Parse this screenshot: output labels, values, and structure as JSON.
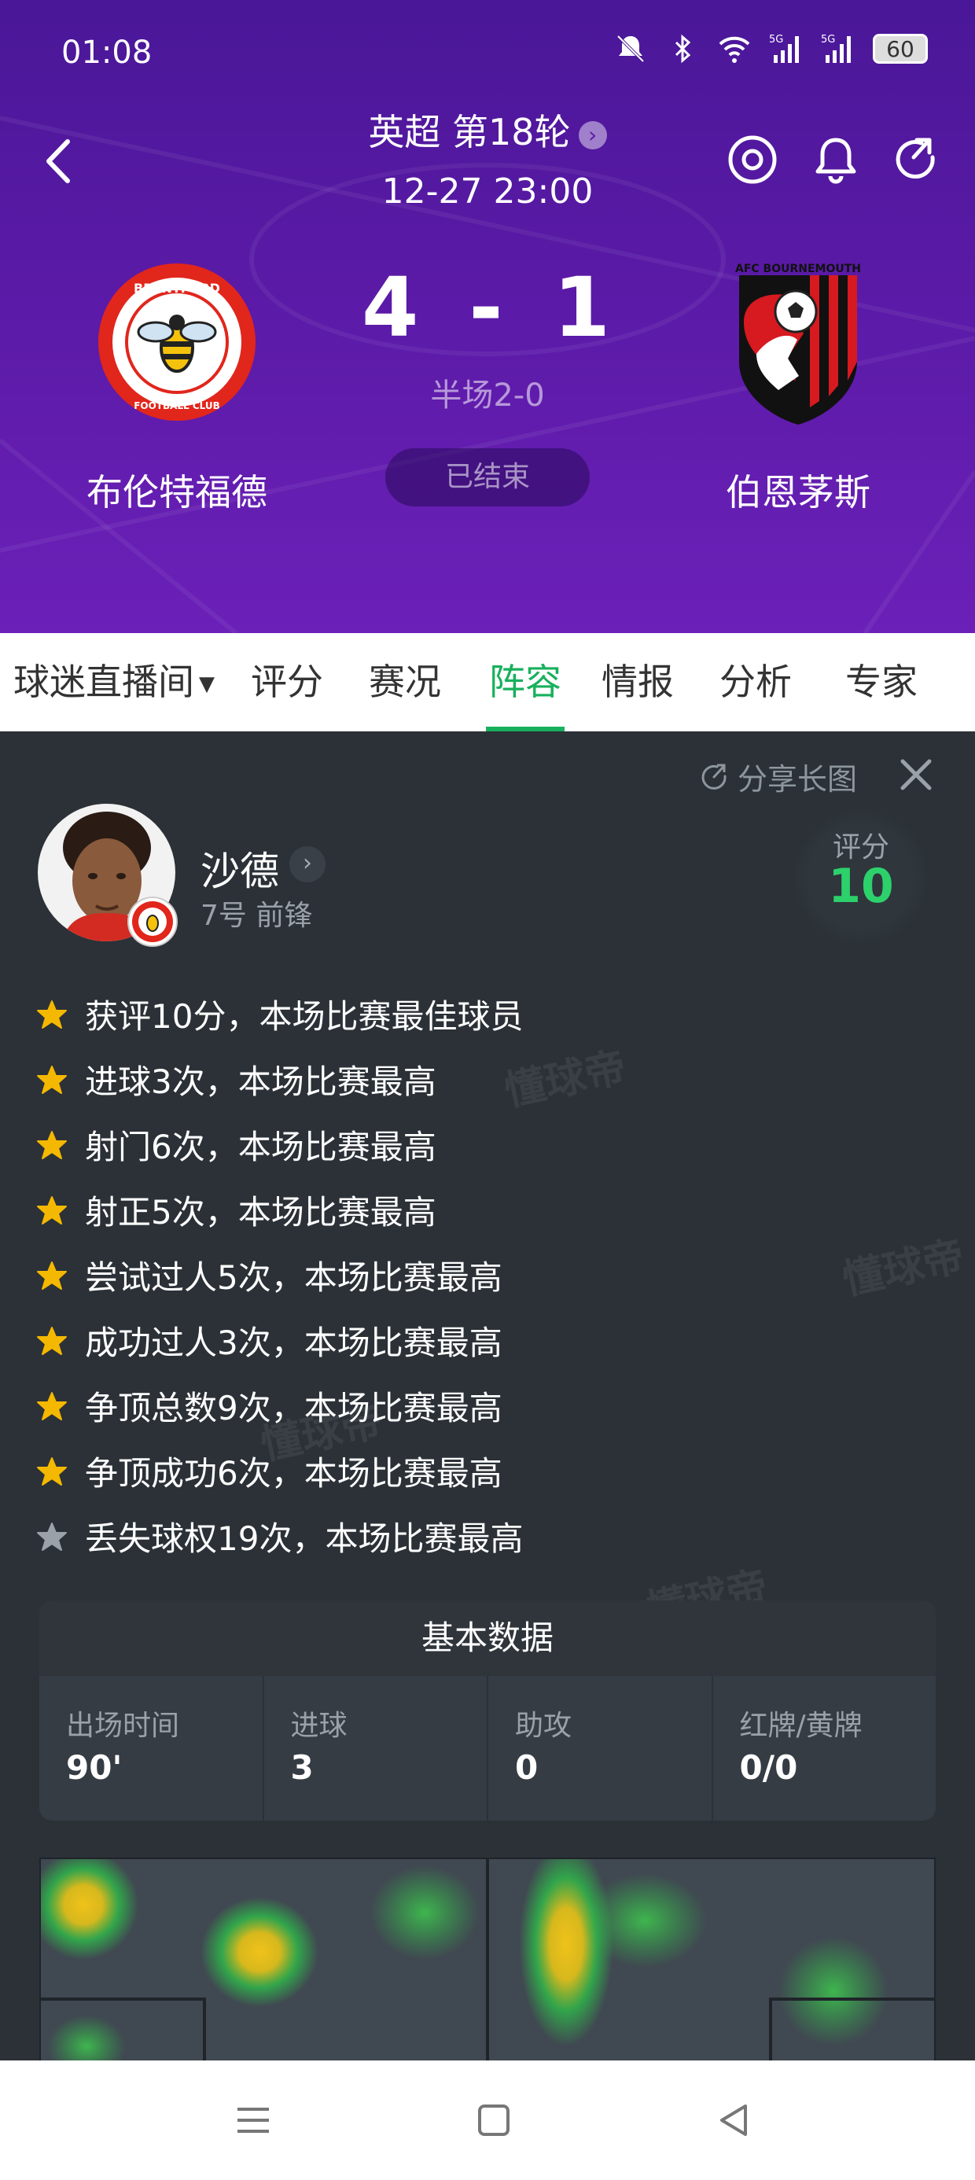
{
  "status_bar": {
    "time": "01:08",
    "battery": "60",
    "icons": [
      "mute-bell-icon",
      "bluetooth-icon",
      "wifi-icon",
      "signal-5g-icon",
      "signal-5g-icon"
    ]
  },
  "match": {
    "round": "英超 第18轮",
    "datetime": "12-27 23:00",
    "home_score": "4",
    "separator": "-",
    "away_score": "1",
    "halftime": "半场2-0",
    "status": "已结束",
    "home_team": "布伦特福德",
    "away_team": "伯恩茅斯",
    "home_logo_text": "BRENTFORD",
    "away_logo_text": "AFC BOURNEMOUTH"
  },
  "tabs": [
    {
      "label": "球迷直播间",
      "active": false
    },
    {
      "label": "评分",
      "active": false
    },
    {
      "label": "赛况",
      "active": false
    },
    {
      "label": "阵容",
      "active": true
    },
    {
      "label": "情报",
      "active": false
    },
    {
      "label": "分析",
      "active": false
    },
    {
      "label": "专家",
      "active": false
    }
  ],
  "panel": {
    "share_label": "分享长图",
    "player_name": "沙德",
    "player_position": "7号 前锋",
    "rating_label": "评分",
    "rating_value": "10",
    "highlights": [
      {
        "text": "获评10分，本场比赛最佳球员",
        "star": "gold"
      },
      {
        "text": "进球3次，本场比赛最高",
        "star": "gold"
      },
      {
        "text": "射门6次，本场比赛最高",
        "star": "gold"
      },
      {
        "text": "射正5次，本场比赛最高",
        "star": "gold"
      },
      {
        "text": "尝试过人5次，本场比赛最高",
        "star": "gold"
      },
      {
        "text": "成功过人3次，本场比赛最高",
        "star": "gold"
      },
      {
        "text": "争顶总数9次，本场比赛最高",
        "star": "gold"
      },
      {
        "text": "争顶成功6次，本场比赛最高",
        "star": "gold"
      },
      {
        "text": "丢失球权19次，本场比赛最高",
        "star": "gray"
      }
    ],
    "basic_stats_title": "基本数据",
    "basic_stats": [
      {
        "label": "出场时间",
        "value": "90'"
      },
      {
        "label": "进球",
        "value": "3"
      },
      {
        "label": "助攻",
        "value": "0"
      },
      {
        "label": "红牌/黄牌",
        "value": "0/0"
      }
    ],
    "watermark": "懂球帝"
  },
  "colors": {
    "header_purple": "#5a1aa6",
    "accent_green": "#18b05d",
    "rating_green": "#2cd16b",
    "panel_bg": "#2b3137",
    "gold_star": "#f5b800"
  }
}
